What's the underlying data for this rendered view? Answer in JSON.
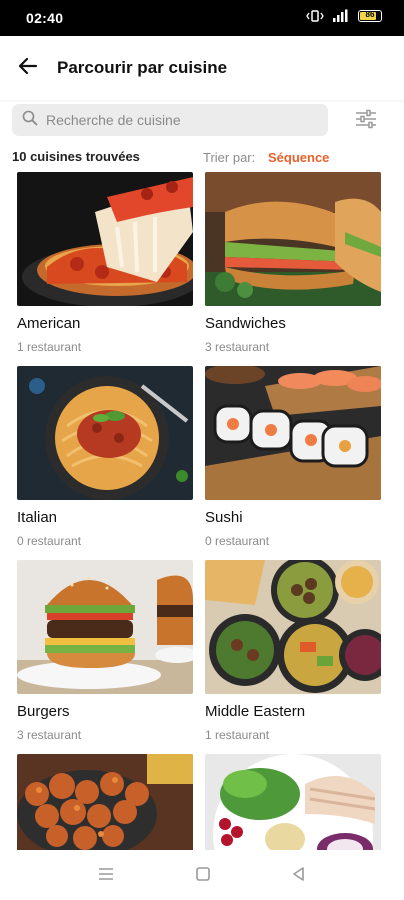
{
  "status_bar": {
    "time": "02:40",
    "icons": [
      "vibrate-icon",
      "signal-icon",
      "battery-icon"
    ],
    "battery_level": "86"
  },
  "header": {
    "title": "Parcourir par cuisine",
    "back_icon": "arrow-left-icon"
  },
  "search": {
    "placeholder": "Recherche de cuisine",
    "icon": "search-icon",
    "filter_icon": "sliders-icon"
  },
  "results": {
    "count_text": "10 cuisines trouvées",
    "sort_label": "Trier par:",
    "sort_value": "Séquence"
  },
  "colors": {
    "accent": "#e8622c",
    "muted": "#8a8a8a",
    "search_bg": "#ececec"
  },
  "cuisines": [
    {
      "name": "American",
      "count": "1 restaurant"
    },
    {
      "name": "Sandwiches",
      "count": "3 restaurant"
    },
    {
      "name": "Italian",
      "count": "0 restaurant"
    },
    {
      "name": "Sushi",
      "count": "0 restaurant"
    },
    {
      "name": "Burgers",
      "count": "3 restaurant"
    },
    {
      "name": "Middle Eastern",
      "count": "1 restaurant"
    },
    {
      "name": "",
      "count": ""
    },
    {
      "name": "",
      "count": ""
    }
  ],
  "nav": {
    "items": [
      "menu-icon",
      "home-square-icon",
      "back-triangle-icon"
    ]
  }
}
